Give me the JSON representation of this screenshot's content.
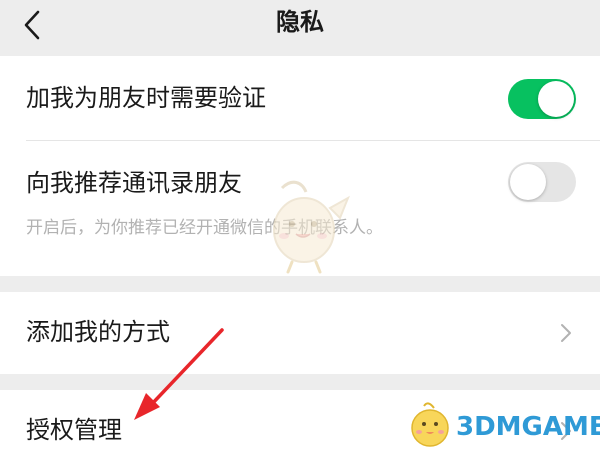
{
  "header": {
    "title": "隐私",
    "back_icon": "chevron-left-icon"
  },
  "section_verification": {
    "rows": [
      {
        "label": "加我为朋友时需要验证",
        "toggle_state": "on"
      },
      {
        "label": "向我推荐通讯录朋友",
        "toggle_state": "off",
        "hint": "开启后，为你推荐已经开通微信的手机联系人。"
      }
    ]
  },
  "section_add": {
    "label": "添加我的方式",
    "icon": "chevron-right-icon"
  },
  "section_auth": {
    "label": "授权管理",
    "icon": "chevron-right-icon"
  },
  "overlay": {
    "watermark_text": "3DMGAME",
    "arrow_color": "#e8262b"
  },
  "colors": {
    "background": "#ededed",
    "toggle_on": "#07c160",
    "toggle_off": "#e5e5e5",
    "hint": "#b2b2b2",
    "brand": "#2f9ad6"
  }
}
